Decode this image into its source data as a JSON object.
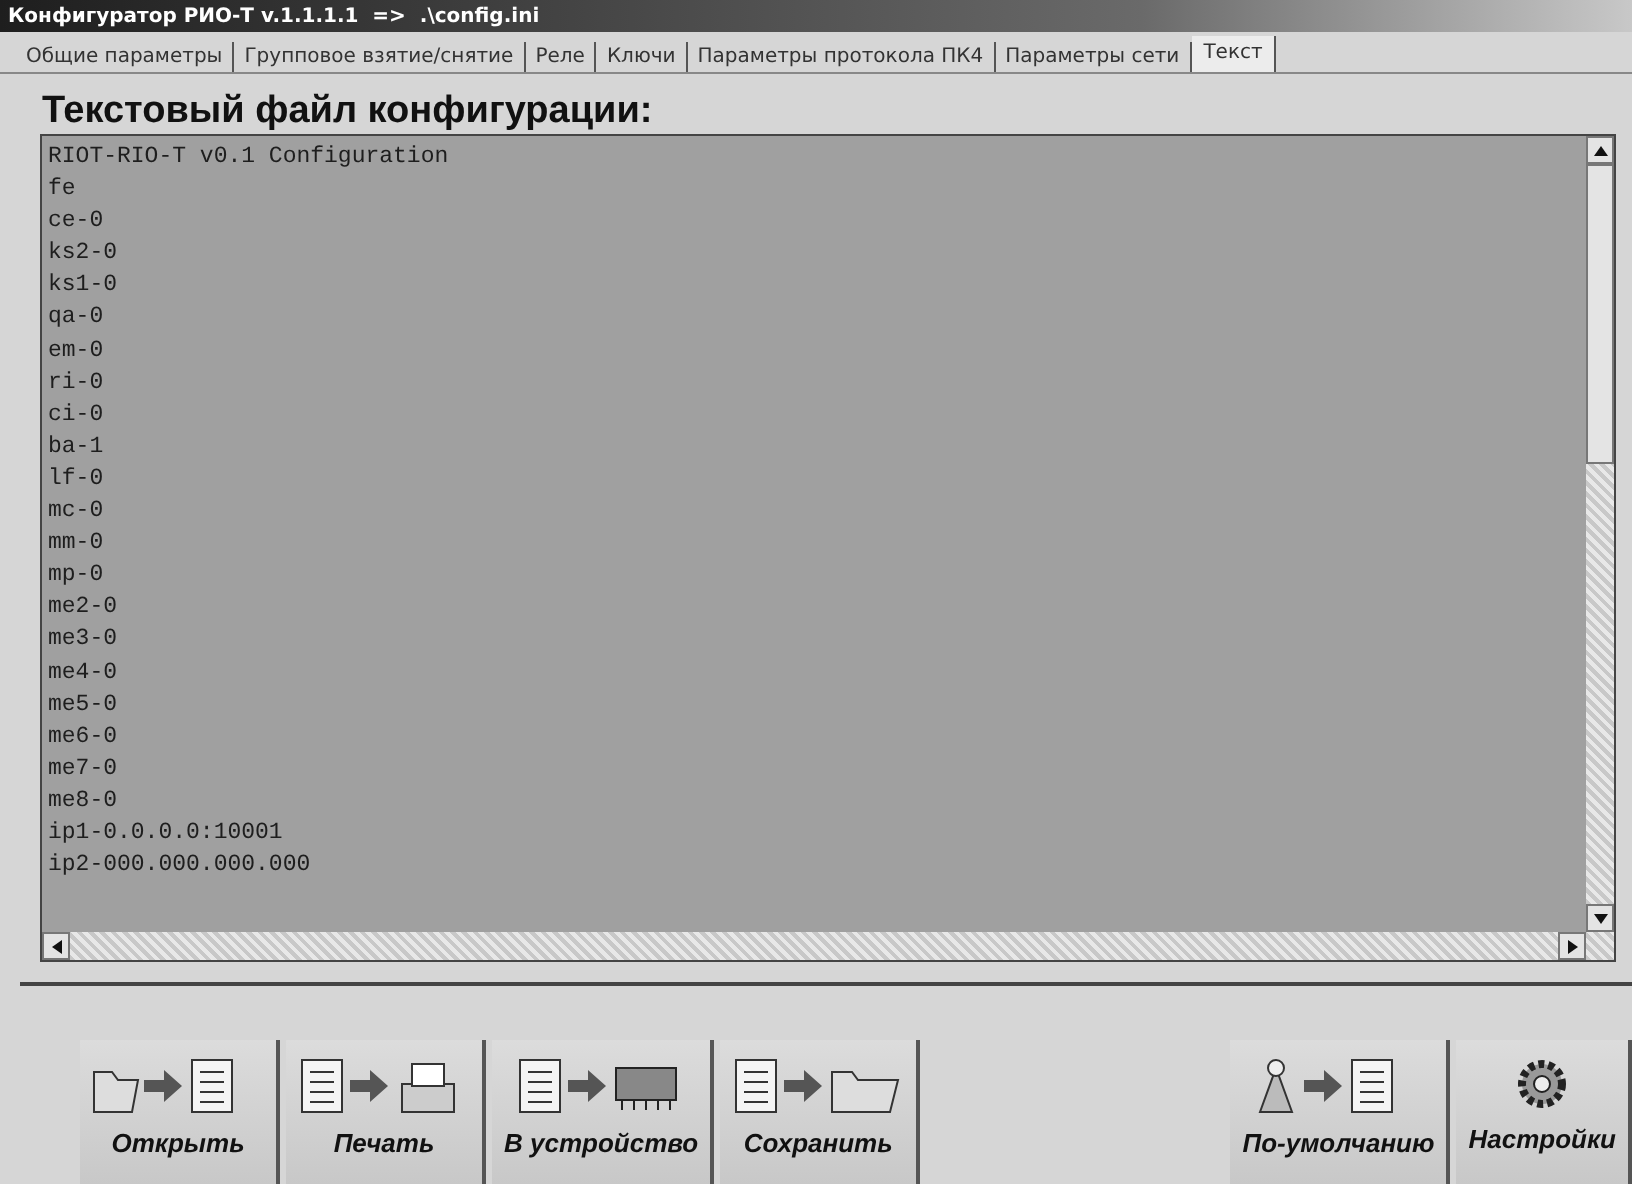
{
  "window": {
    "title": "Конфигуратор РИО-Т v.1.1.1.1  =>  .\\config.ini"
  },
  "tabs": [
    {
      "label": "Общие параметры",
      "selected": false
    },
    {
      "label": "Групповое взятие/снятие",
      "selected": false
    },
    {
      "label": "Реле",
      "selected": false
    },
    {
      "label": "Ключи",
      "selected": false
    },
    {
      "label": "Параметры протокола ПК4",
      "selected": false
    },
    {
      "label": "Параметры сети",
      "selected": false
    },
    {
      "label": "Текст",
      "selected": true
    }
  ],
  "heading": "Текстовый файл конфигурации:",
  "editor": {
    "lines": [
      "RIOT-RIO-T v0.1 Configuration",
      "fe",
      "ce-0",
      "ks2-0",
      "ks1-0",
      "qa-0",
      "em-0",
      "ri-0",
      "ci-0",
      "ba-1",
      "lf-0",
      "mc-0",
      "mm-0",
      "mp-0",
      "me2-0",
      "me3-0",
      "me4-0",
      "me5-0",
      "me6-0",
      "me7-0",
      "me8-0",
      "ip1-0.0.0.0:10001",
      "ip2-000.000.000.000"
    ]
  },
  "toolbar": [
    {
      "label": "Открыть",
      "kind": "open"
    },
    {
      "label": "Печать",
      "kind": "print"
    },
    {
      "label": "В устройство",
      "kind": "device"
    },
    {
      "label": "Сохранить",
      "kind": "save"
    },
    {
      "label": "По-умолчанию",
      "kind": "defaults"
    },
    {
      "label": "Настройки",
      "kind": "settings"
    }
  ]
}
